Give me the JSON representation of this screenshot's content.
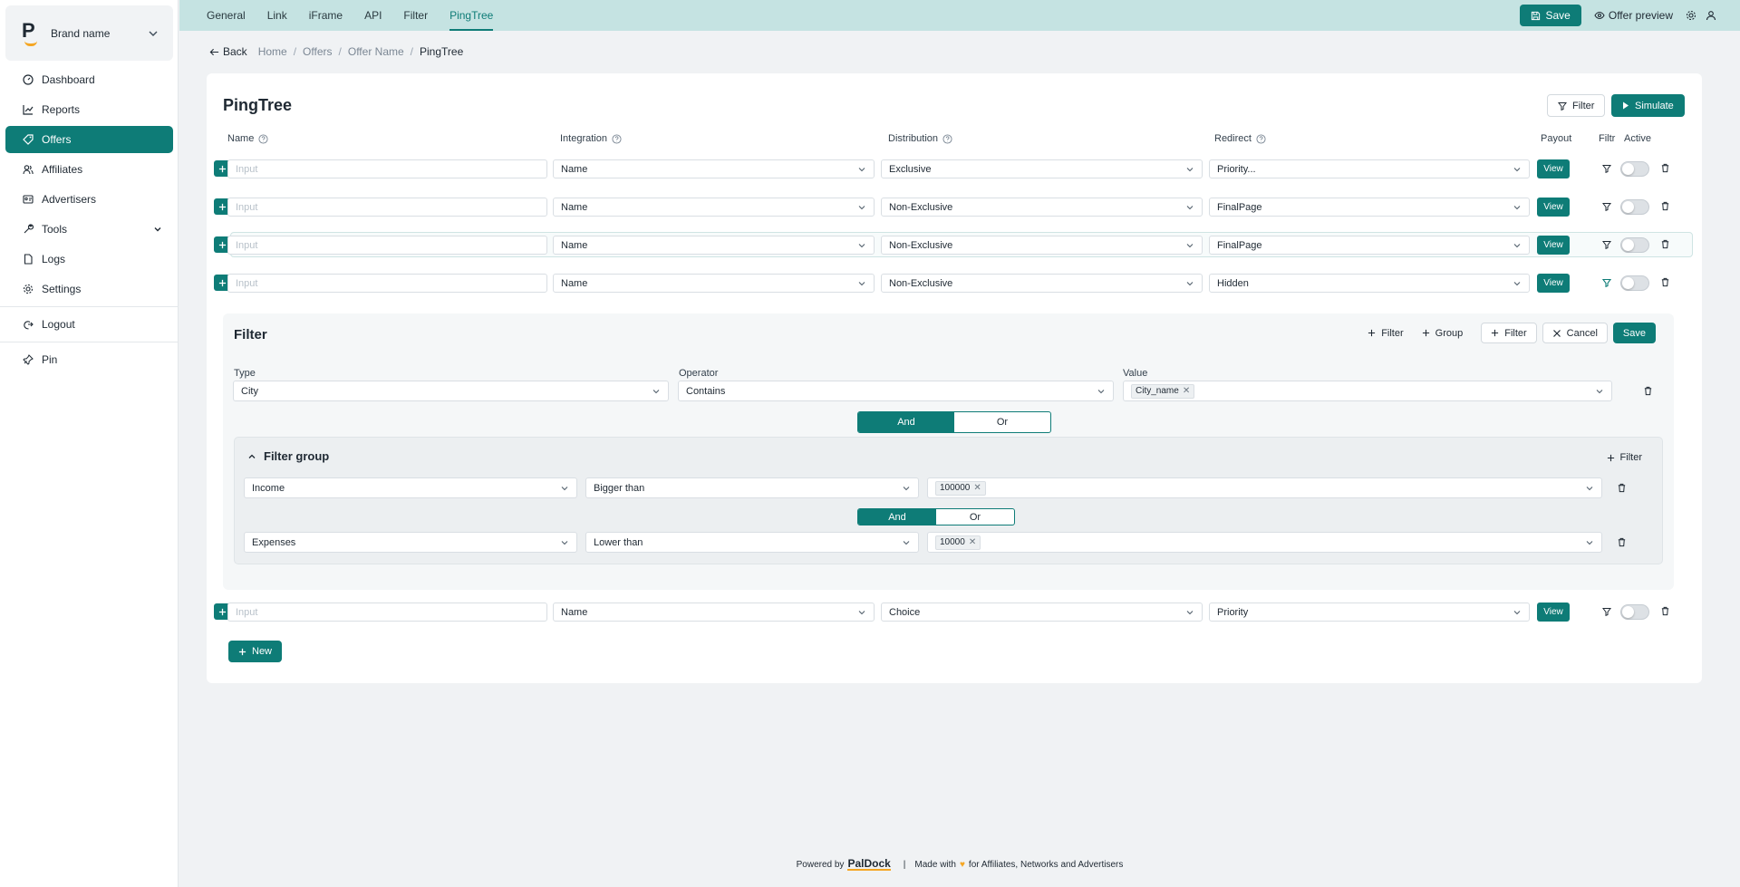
{
  "brand": {
    "name": "Brand name",
    "logo_letter": "P"
  },
  "sidebar": {
    "items": [
      {
        "label": "Dashboard",
        "icon": "dashboard-icon"
      },
      {
        "label": "Reports",
        "icon": "chart-icon"
      },
      {
        "label": "Offers",
        "icon": "tag-icon",
        "active": true
      },
      {
        "label": "Affiliates",
        "icon": "users-icon"
      },
      {
        "label": "Advertisers",
        "icon": "id-card-icon"
      },
      {
        "label": "Tools",
        "icon": "wrench-icon"
      },
      {
        "label": "Logs",
        "icon": "file-icon"
      },
      {
        "label": "Settings",
        "icon": "gear-icon"
      },
      {
        "label": "Logout",
        "icon": "logout-icon"
      },
      {
        "label": "Pin",
        "icon": "pin-icon"
      }
    ]
  },
  "tabs": [
    "General",
    "Link",
    "iFrame",
    "API",
    "Filter",
    "PingTree"
  ],
  "active_tab": "PingTree",
  "topbar": {
    "save_label": "Save",
    "preview_label": "Offer preview"
  },
  "breadcrumb": {
    "back": "Back",
    "items": [
      "Home",
      "Offers",
      "Offer Name"
    ],
    "current": "PingTree"
  },
  "page": {
    "title": "PingTree",
    "filter_label": "Filter",
    "simulate_label": "Simulate"
  },
  "columns": {
    "name": "Name",
    "integration": "Integration",
    "distribution": "Distribution",
    "redirect": "Redirect",
    "payout": "Payout",
    "filtr": "Filtr",
    "active": "Active"
  },
  "rows": [
    {
      "placeholder": "Input",
      "integration": "Name",
      "distribution": "Exclusive",
      "redirect": "Priority...",
      "payout": "View"
    },
    {
      "placeholder": "Input",
      "integration": "Name",
      "distribution": "Non-Exclusive",
      "redirect": "FinalPage",
      "payout": "View"
    },
    {
      "placeholder": "Input",
      "integration": "Name",
      "distribution": "Non-Exclusive",
      "redirect": "FinalPage",
      "payout": "View"
    },
    {
      "placeholder": "Input",
      "integration": "Name",
      "distribution": "Non-Exclusive",
      "redirect": "Hidden",
      "payout": "View"
    },
    {
      "placeholder": "Input",
      "integration": "Name",
      "distribution": "Choice",
      "redirect": "Priority",
      "payout": "View"
    }
  ],
  "filter_panel": {
    "title": "Filter",
    "add_filter": "Filter",
    "add_group": "Group",
    "outline_filter": "Filter",
    "cancel": "Cancel",
    "save": "Save",
    "labels": {
      "type": "Type",
      "operator": "Operator",
      "value": "Value"
    },
    "condition": {
      "type": "City",
      "operator": "Contains",
      "tag": "City_name"
    },
    "logic": {
      "and": "And",
      "or": "Or"
    },
    "group": {
      "title": "Filter group",
      "add_filter": "Filter",
      "rows": [
        {
          "type": "Income",
          "operator": "Bigger than",
          "tag": "100000"
        },
        {
          "type": "Expenses",
          "operator": "Lower than",
          "tag": "10000"
        }
      ],
      "logic": {
        "and": "And",
        "or": "Or"
      }
    }
  },
  "new_button": "New",
  "footer": {
    "powered": "Powered by",
    "brand": "PalDock",
    "made": "Made with",
    "for": "for Affiliates, Networks and Advertisers"
  },
  "colors": {
    "accent": "#0e7c77",
    "topbar": "#c5e3e2",
    "brand_orange": "#f5a623"
  }
}
